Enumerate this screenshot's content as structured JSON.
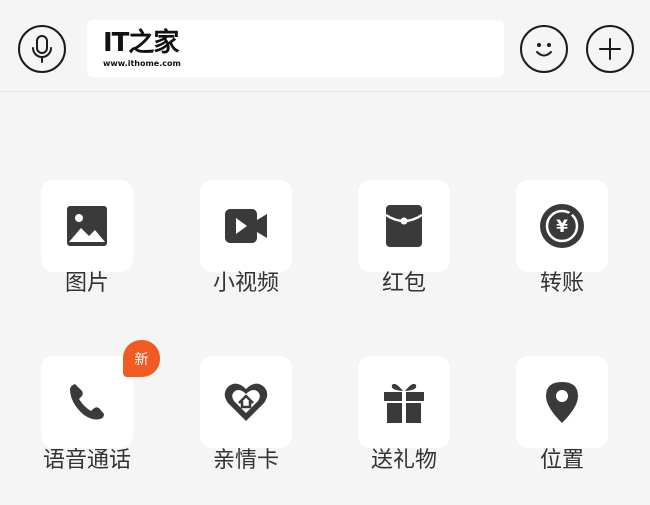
{
  "input": {
    "logo_mark": "IT之家",
    "logo_url": "www.ithome.com"
  },
  "panel": {
    "items": [
      {
        "label": "图片",
        "icon": "image-icon"
      },
      {
        "label": "小视频",
        "icon": "video-icon"
      },
      {
        "label": "红包",
        "icon": "red-packet-icon"
      },
      {
        "label": "转账",
        "icon": "transfer-icon"
      },
      {
        "label": "语音通话",
        "icon": "phone-icon",
        "badge": "新"
      },
      {
        "label": "亲情卡",
        "icon": "heart-card-icon"
      },
      {
        "label": "送礼物",
        "icon": "gift-icon"
      },
      {
        "label": "位置",
        "icon": "location-icon"
      }
    ]
  },
  "colors": {
    "background": "#f5f5f5",
    "tile": "#ffffff",
    "icon": "#3a3a3a",
    "badge": "#f25a24"
  }
}
